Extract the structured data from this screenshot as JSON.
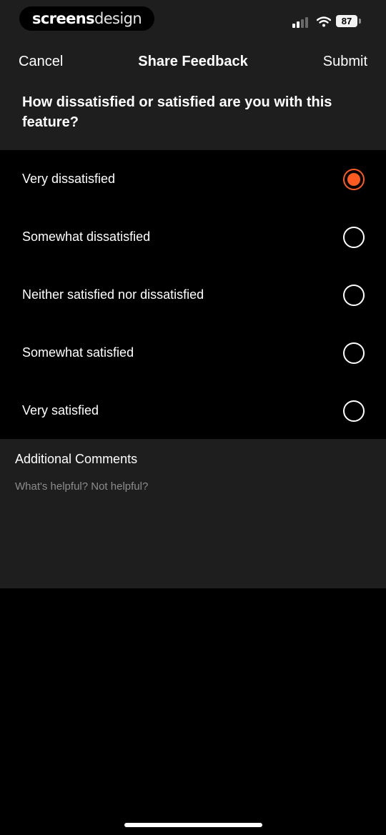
{
  "status_bar": {
    "brand": {
      "part1": "screens",
      "part2": "design"
    },
    "battery": "87"
  },
  "nav": {
    "cancel_label": "Cancel",
    "title": "Share Feedback",
    "submit_label": "Submit"
  },
  "question": "How dissatisfied or satisfied are you with this feature?",
  "options": [
    {
      "label": "Very dissatisfied",
      "selected": true
    },
    {
      "label": "Somewhat dissatisfied",
      "selected": false
    },
    {
      "label": "Neither satisfied nor dissatisfied",
      "selected": false
    },
    {
      "label": "Somewhat satisfied",
      "selected": false
    },
    {
      "label": "Very satisfied",
      "selected": false
    }
  ],
  "comments": {
    "title": "Additional Comments",
    "placeholder": "What's helpful? Not helpful?"
  },
  "colors": {
    "accent": "#ff5a1f",
    "panel": "#1e1e1e",
    "background": "#000000"
  }
}
